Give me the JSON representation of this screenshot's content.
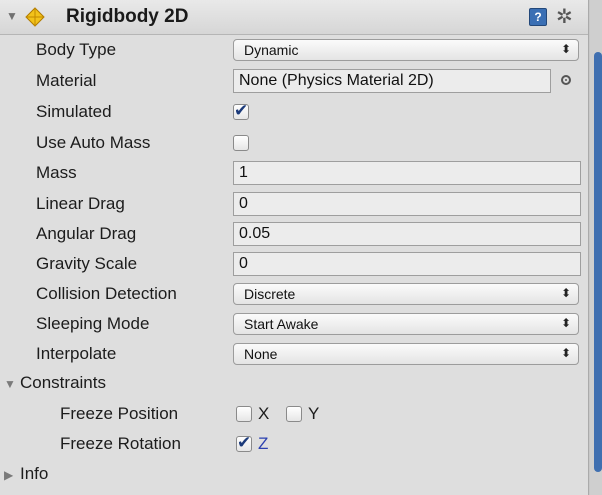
{
  "component": {
    "title": "Rigidbody 2D",
    "help_icon_glyph": "?",
    "gear_glyph": "✲"
  },
  "fields": {
    "body_type": {
      "label": "Body Type",
      "value": "Dynamic"
    },
    "material": {
      "label": "Material",
      "value": "None (Physics Material 2D)"
    },
    "simulated": {
      "label": "Simulated",
      "checked": true
    },
    "use_auto_mass": {
      "label": "Use Auto Mass",
      "checked": false
    },
    "mass": {
      "label": "Mass",
      "value": "1"
    },
    "linear_drag": {
      "label": "Linear Drag",
      "value": "0"
    },
    "angular_drag": {
      "label": "Angular Drag",
      "value": "0.05"
    },
    "gravity_scale": {
      "label": "Gravity Scale",
      "value": "0"
    },
    "collision_detection": {
      "label": "Collision Detection",
      "value": "Discrete"
    },
    "sleeping_mode": {
      "label": "Sleeping Mode",
      "value": "Start Awake"
    },
    "interpolate": {
      "label": "Interpolate",
      "value": "None"
    }
  },
  "constraints": {
    "label": "Constraints",
    "expanded": true,
    "freeze_position": {
      "label": "Freeze Position",
      "x_label": "X",
      "y_label": "Y",
      "x_checked": false,
      "y_checked": false
    },
    "freeze_rotation": {
      "label": "Freeze Rotation",
      "z_label": "Z",
      "z_checked": true
    }
  },
  "info": {
    "label": "Info",
    "expanded": false
  },
  "glyphs": {
    "fold_open": "▼",
    "fold_closed": "▶",
    "popup_arrows": "⬍",
    "check": "✔"
  },
  "colors": {
    "accent": "#3f6fb0",
    "panel_bg": "#dedede",
    "check": "#1b3a7a"
  }
}
